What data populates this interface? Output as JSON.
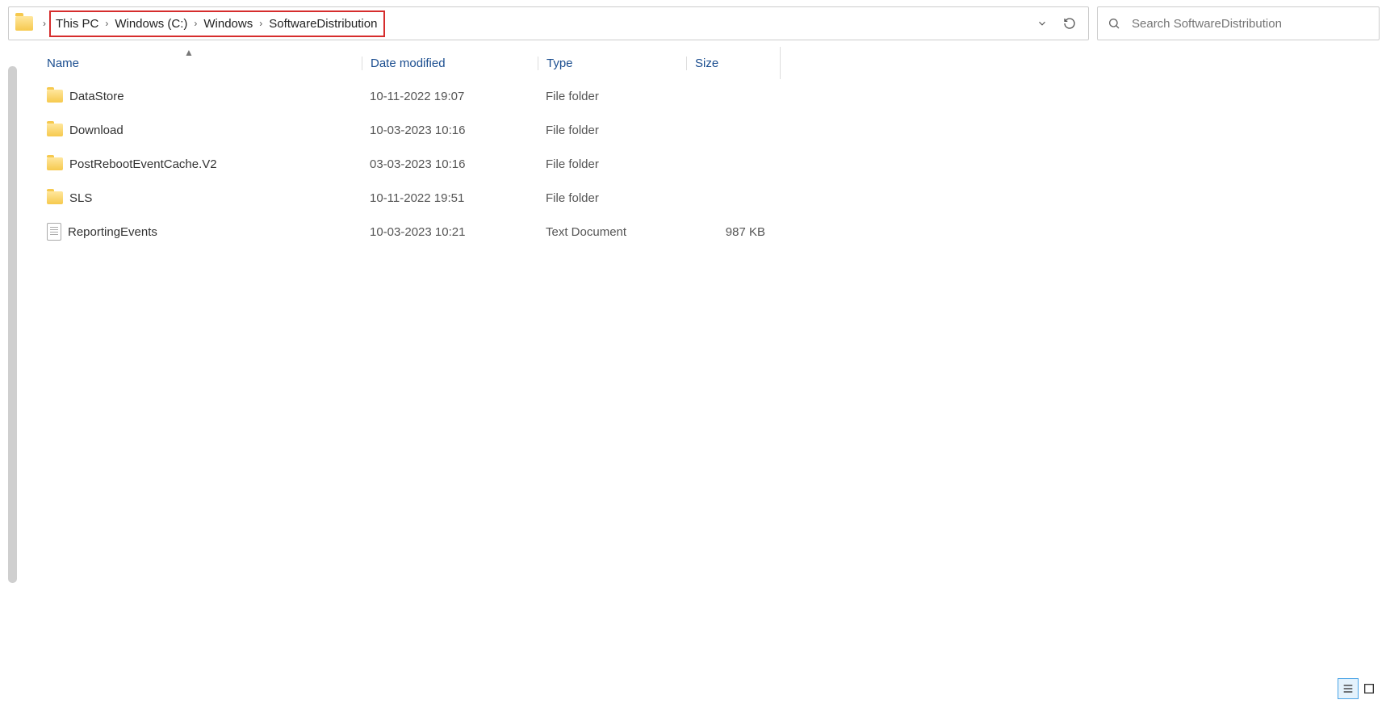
{
  "breadcrumb": {
    "segments": [
      "This PC",
      "Windows (C:)",
      "Windows",
      "SoftwareDistribution"
    ]
  },
  "search": {
    "placeholder": "Search SoftwareDistribution"
  },
  "columns": {
    "name": "Name",
    "date": "Date modified",
    "type": "Type",
    "size": "Size"
  },
  "items": [
    {
      "icon": "folder",
      "name": "DataStore",
      "date": "10-11-2022 19:07",
      "type": "File folder",
      "size": ""
    },
    {
      "icon": "folder",
      "name": "Download",
      "date": "10-03-2023 10:16",
      "type": "File folder",
      "size": ""
    },
    {
      "icon": "folder",
      "name": "PostRebootEventCache.V2",
      "date": "03-03-2023 10:16",
      "type": "File folder",
      "size": ""
    },
    {
      "icon": "folder",
      "name": "SLS",
      "date": "10-11-2022 19:51",
      "type": "File folder",
      "size": ""
    },
    {
      "icon": "file",
      "name": "ReportingEvents",
      "date": "10-03-2023 10:21",
      "type": "Text Document",
      "size": "987 KB"
    }
  ]
}
